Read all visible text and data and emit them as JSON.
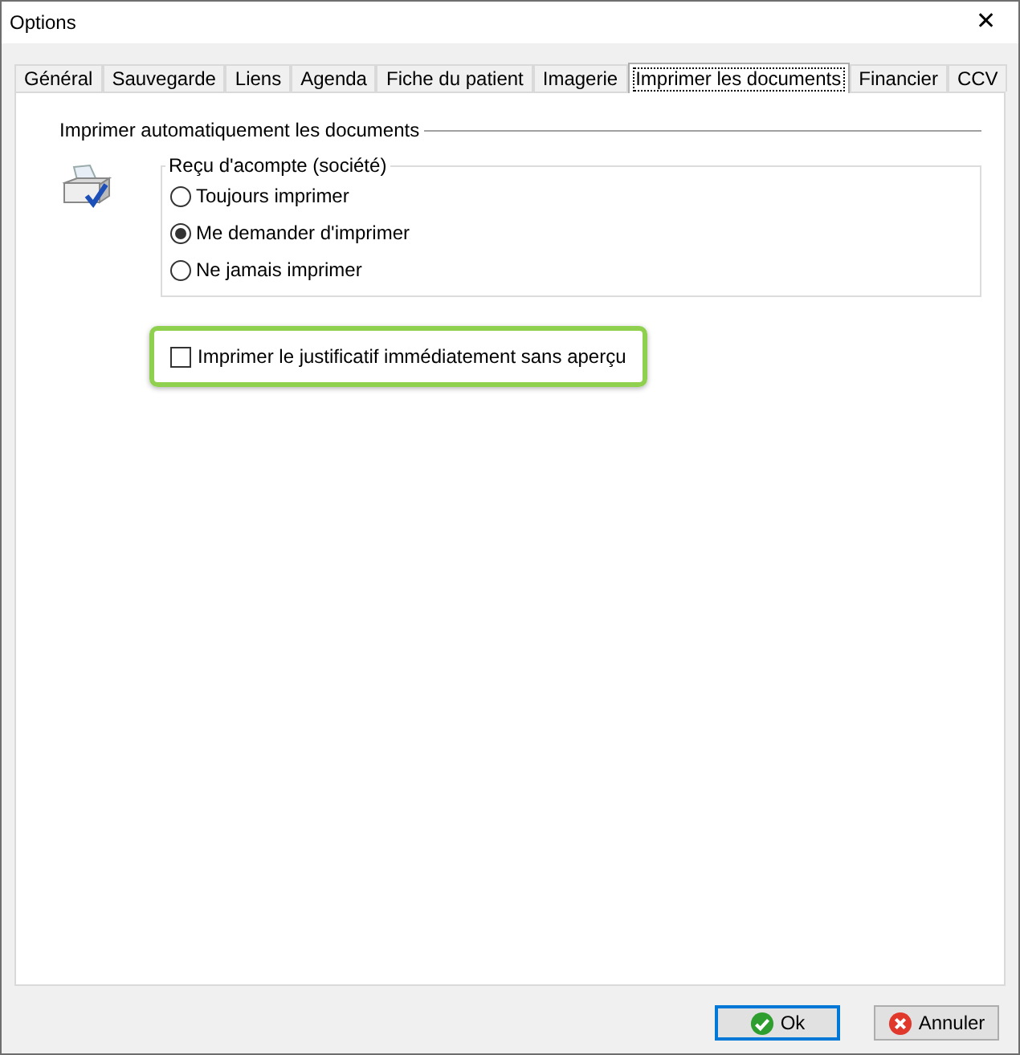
{
  "window": {
    "title": "Options",
    "close": "✕"
  },
  "tabs": [
    {
      "label": "Général",
      "selected": false
    },
    {
      "label": "Sauvegarde",
      "selected": false
    },
    {
      "label": "Liens",
      "selected": false
    },
    {
      "label": "Agenda",
      "selected": false
    },
    {
      "label": "Fiche du patient",
      "selected": false
    },
    {
      "label": "Imagerie",
      "selected": false
    },
    {
      "label": "Imprimer les documents",
      "selected": true
    },
    {
      "label": "Financier",
      "selected": false
    },
    {
      "label": "CCV",
      "selected": false
    }
  ],
  "section": {
    "title": "Imprimer automatiquement les documents",
    "group": {
      "title": "Reçu d'acompte (société)",
      "options": [
        {
          "label": "Toujours imprimer",
          "selected": false
        },
        {
          "label": "Me demander d'imprimer",
          "selected": true
        },
        {
          "label": "Ne jamais imprimer",
          "selected": false
        }
      ]
    },
    "checkbox": {
      "label": "Imprimer le justificatif immédiatement sans aperçu",
      "checked": false,
      "highlighted": true
    }
  },
  "buttons": [
    {
      "label": "Ok",
      "kind": "ok",
      "default": true
    },
    {
      "label": "Annuler",
      "kind": "cancel",
      "default": false
    }
  ]
}
